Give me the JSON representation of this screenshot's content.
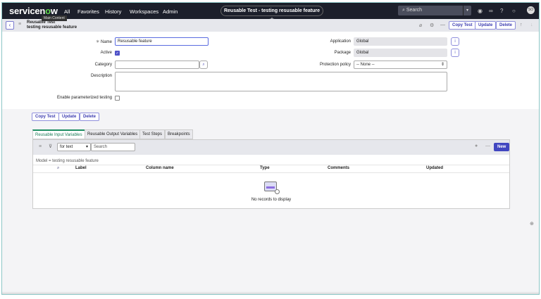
{
  "header": {
    "logo_pre": "servicen",
    "logo_o": "o",
    "logo_post": "w",
    "tooltip": "Main Content",
    "nav": [
      "All",
      "Favorites",
      "History",
      "Workspaces",
      "Admin"
    ],
    "record_pill": "Reusable Test - testing resusable feature ☆",
    "search_placeholder": "Search",
    "avatar": "SO"
  },
  "subheader": {
    "table": "Reusable Test",
    "record": "testing resusable feature",
    "copy": "Copy Test",
    "update": "Update",
    "delete": "Delete"
  },
  "form": {
    "name_label": "Name",
    "name_value": "Resusable feature",
    "active_label": "Active",
    "category_label": "Category",
    "description_label": "Description",
    "enable_label": "Enable parameterized testing",
    "application_label": "Application",
    "application_value": "Global",
    "package_label": "Package",
    "package_value": "Global",
    "protection_label": "Protection policy",
    "protection_value": "-- None --"
  },
  "actions": {
    "copy": "Copy Test",
    "update": "Update",
    "delete": "Delete"
  },
  "tabs": [
    "Reusable Input Variables",
    "Reusable Output Variables",
    "Test Steps",
    "Breakpoints"
  ],
  "list": {
    "filter_field": "for text",
    "search_placeholder": "Search",
    "new": "New",
    "breadcrumb": "Model = testing resusable feature",
    "columns": [
      "Label",
      "Column name",
      "Type",
      "Comments",
      "Updated"
    ],
    "empty": "No records to display"
  }
}
